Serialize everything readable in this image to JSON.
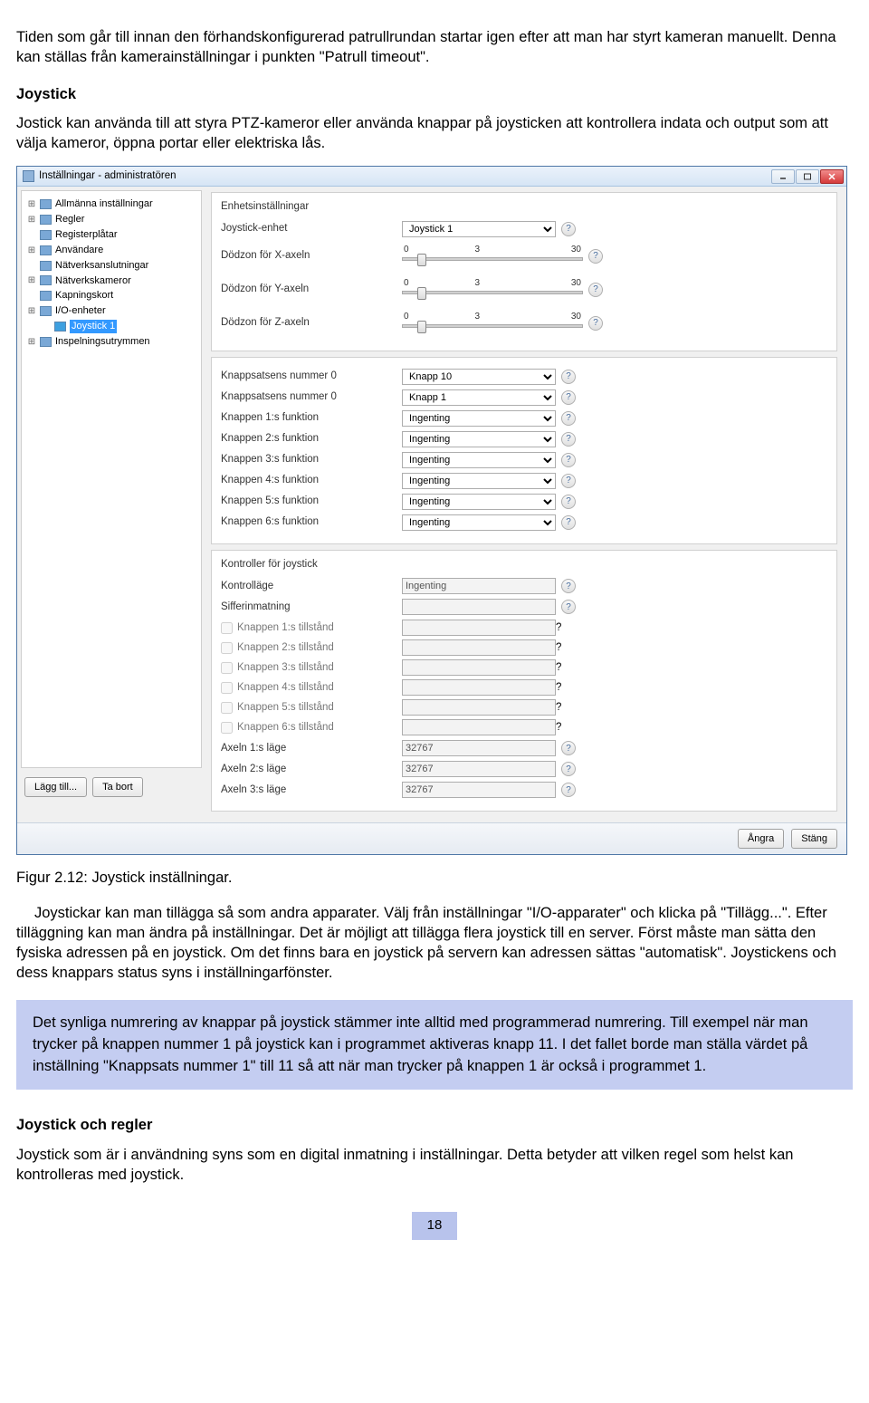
{
  "doc": {
    "para_intro": "Tiden som går till innan den förhandskonfigurerad patrullrundan startar igen efter att man har styrt kameran manuellt. Denna kan ställas från kamerainställningar i punkten \"Patrull timeout\".",
    "heading_joystick": "Joystick",
    "para_joystick": "Jostick kan använda till att styra PTZ-kameror eller använda knappar på joysticken att kontrollera indata och output som att välja kameror, öppna portar eller elektriska lås.",
    "fig_caption": "Figur 2.12: Joystick inställningar.",
    "para_after_fig": "Joystickar kan man tillägga så som andra apparater. Välj från inställningar \"I/O-apparater\" och klicka på \"Tillägg...\". Efter tilläggning kan man ändra på inställningar. Det är möjligt att tillägga flera joystick till en server. Först måste man sätta den fysiska adressen på en joystick. Om det finns bara en joystick på servern kan adressen sättas \"automatisk\". Joystickens och dess knappars status syns i inställningarfönster.",
    "note_text": "Det synliga numrering av knappar på joystick stämmer inte alltid med programmerad numrering. Till exempel när man trycker på knappen nummer 1 på joystick kan i programmet aktiveras knapp 11. I det fallet borde man ställa värdet på inställning \"Knappsats nummer 1\" till 11 så att när man trycker på knappen 1 är också i programmet 1.",
    "heading_rules": "Joystick och regler",
    "para_rules": "Joystick som är i användning syns som en digital inmatning i inställningar. Detta betyder att vilken regel som helst kan kontrolleras med joystick.",
    "page_number": "18"
  },
  "window": {
    "title": "Inställningar - administratören",
    "tree": {
      "items": [
        {
          "label": "Allmänna inställningar",
          "expandable": true
        },
        {
          "label": "Regler",
          "expandable": true
        },
        {
          "label": "Registerplåtar"
        },
        {
          "label": "Användare",
          "expandable": true
        },
        {
          "label": "Nätverksanslutningar"
        },
        {
          "label": "Nätverkskameror",
          "expandable": true
        },
        {
          "label": "Kapningskort"
        },
        {
          "label": "I/O-enheter",
          "expandable": true
        },
        {
          "label": "Joystick 1",
          "selected": true,
          "sub": true
        },
        {
          "label": "Inspelningsutrymmen",
          "expandable": true
        }
      ]
    },
    "buttons": {
      "add": "Lägg till...",
      "remove": "Ta bort",
      "undo": "Ångra",
      "close": "Stäng"
    },
    "unit_panel": {
      "title": "Enhetsinställningar",
      "device_label": "Joystick-enhet",
      "device_value": "Joystick 1",
      "deadzone_x": "Dödzon för X-axeln",
      "deadzone_y": "Dödzon för Y-axeln",
      "deadzone_z": "Dödzon för Z-axeln",
      "tick0": "0",
      "tick1": "3",
      "tick2": "30"
    },
    "buttons_panel": {
      "rows": [
        {
          "label": "Knappsatsens nummer 0",
          "value": "Knapp 10",
          "type": "select"
        },
        {
          "label": "Knappsatsens nummer 0",
          "value": "Knapp 1",
          "type": "select"
        },
        {
          "label": "Knappen 1:s funktion",
          "value": "Ingenting",
          "type": "select"
        },
        {
          "label": "Knappen 2:s funktion",
          "value": "Ingenting",
          "type": "select"
        },
        {
          "label": "Knappen 3:s funktion",
          "value": "Ingenting",
          "type": "select"
        },
        {
          "label": "Knappen 4:s funktion",
          "value": "Ingenting",
          "type": "select"
        },
        {
          "label": "Knappen 5:s funktion",
          "value": "Ingenting",
          "type": "select"
        },
        {
          "label": "Knappen 6:s funktion",
          "value": "Ingenting",
          "type": "select"
        }
      ]
    },
    "ctrl_panel": {
      "title": "Kontroller för joystick",
      "mode_label": "Kontrolläge",
      "mode_value": "Ingenting",
      "siffer_label": "Sifferinmatning",
      "checks": [
        "Knappen 1:s tillstånd",
        "Knappen 2:s tillstånd",
        "Knappen 3:s tillstånd",
        "Knappen 4:s tillstånd",
        "Knappen 5:s tillstånd",
        "Knappen 6:s tillstånd"
      ],
      "axes": [
        {
          "label": "Axeln 1:s läge",
          "value": "32767"
        },
        {
          "label": "Axeln 2:s läge",
          "value": "32767"
        },
        {
          "label": "Axeln 3:s läge",
          "value": "32767"
        }
      ]
    }
  }
}
